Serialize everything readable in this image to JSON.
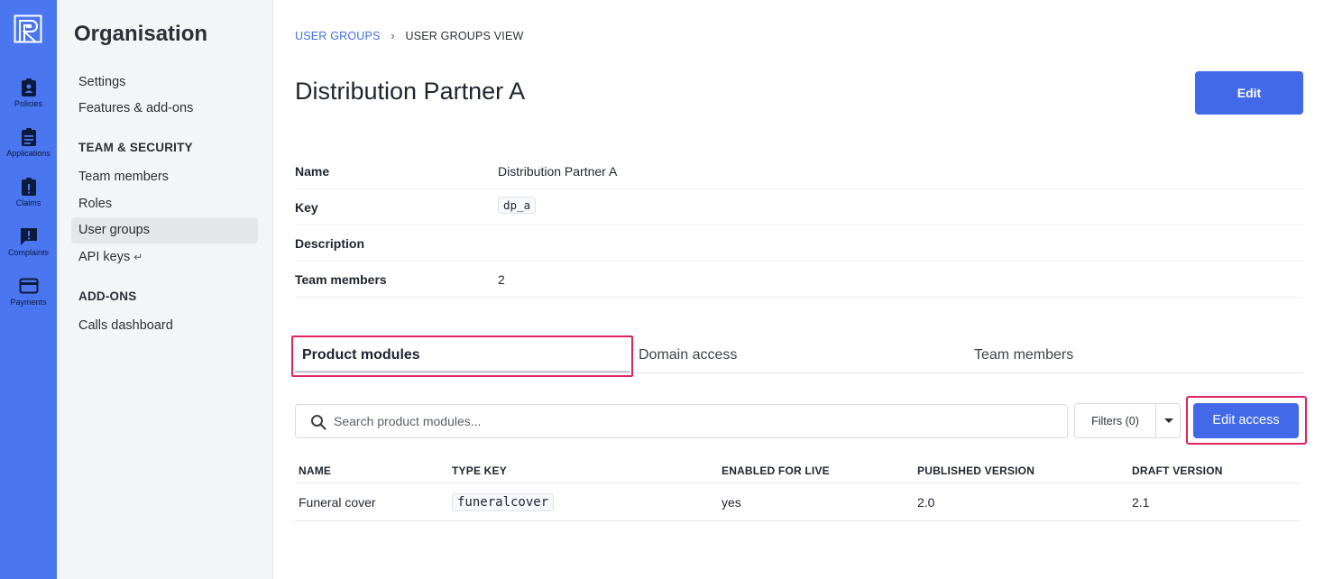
{
  "rail": {
    "items": [
      {
        "label": "Policies",
        "icon": "policy-badge-icon"
      },
      {
        "label": "Applications",
        "icon": "clipboard-icon"
      },
      {
        "label": "Claims",
        "icon": "claims-alert-icon"
      },
      {
        "label": "Complaints",
        "icon": "speech-alert-icon"
      },
      {
        "label": "Payments",
        "icon": "credit-card-icon"
      }
    ],
    "color": "#4a76f0"
  },
  "subnav": {
    "title": "Organisation",
    "items_top": [
      "Settings",
      "Features & add-ons"
    ],
    "section_team": "TEAM & SECURITY",
    "items_team": [
      "Team members",
      "Roles",
      "User groups",
      "API keys"
    ],
    "api_keys_suffix": "↵",
    "section_addons": "ADD-ONS",
    "items_addons": [
      "Calls dashboard"
    ],
    "active": "User groups"
  },
  "breadcrumb": {
    "parent": "USER GROUPS",
    "current": "USER GROUPS VIEW"
  },
  "page": {
    "title": "Distribution Partner A",
    "edit_label": "Edit"
  },
  "details": {
    "name_label": "Name",
    "name_value": "Distribution Partner A",
    "key_label": "Key",
    "key_value": "dp_a",
    "description_label": "Description",
    "description_value": "",
    "team_members_label": "Team members",
    "team_members_value": "2"
  },
  "tabs": {
    "items": [
      "Product modules",
      "Domain access",
      "Team members"
    ],
    "active": "Product modules"
  },
  "toolbar": {
    "search_placeholder": "Search product modules...",
    "filters_label": "Filters (0)",
    "edit_access_label": "Edit access"
  },
  "table": {
    "columns": [
      "NAME",
      "TYPE KEY",
      "ENABLED FOR LIVE",
      "PUBLISHED VERSION",
      "DRAFT VERSION"
    ],
    "rows": [
      {
        "name": "Funeral cover",
        "type_key": "funeralcover",
        "enabled_for_live": "yes",
        "published_version": "2.0",
        "draft_version": "2.1"
      }
    ]
  },
  "colors": {
    "accent": "#4169e8",
    "highlight": "#e0245e"
  }
}
